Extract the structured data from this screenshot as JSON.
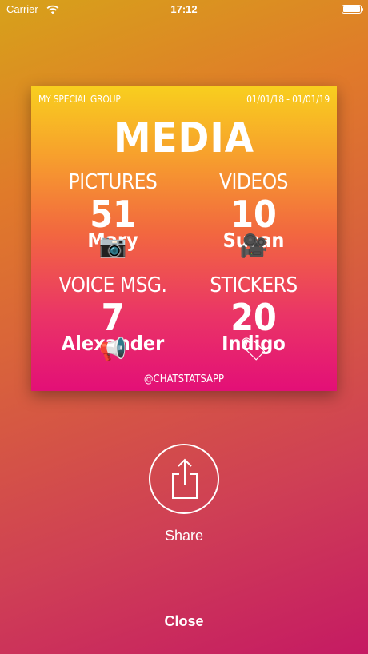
{
  "status_bar": {
    "carrier": "Carrier",
    "time": "17:12"
  },
  "card": {
    "group": "MY SPECIAL GROUP",
    "date_range": "01/01/18 - 01/01/19",
    "title": "MEDIA",
    "stats": [
      {
        "label": "PICTURES",
        "value": "51",
        "emoji": "📷",
        "person": "Mary"
      },
      {
        "label": "VIDEOS",
        "value": "10",
        "emoji": "🎥",
        "person": "Susan"
      },
      {
        "label": "VOICE MSG.",
        "value": "7",
        "emoji": "📢",
        "person": "Alexander"
      },
      {
        "label": "STICKERS",
        "value": "20",
        "emoji": "🏷",
        "person": "Indigo"
      }
    ],
    "footer": "@CHATSTATSAPP"
  },
  "actions": {
    "share_label": "Share",
    "close_label": "Close"
  }
}
